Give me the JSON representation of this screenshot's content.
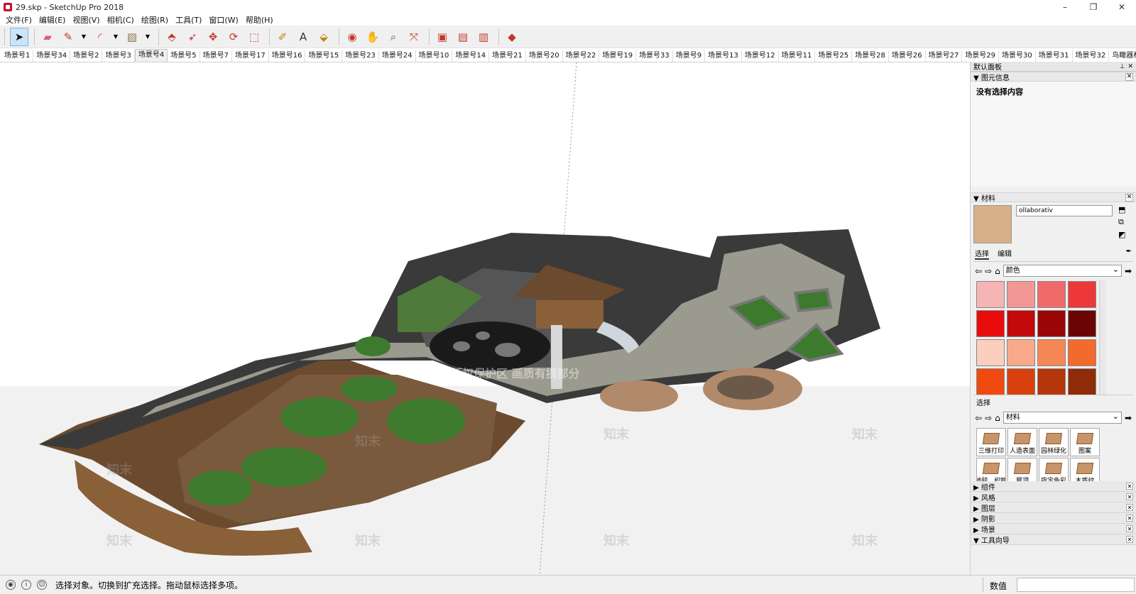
{
  "window": {
    "title": "29.skp - SketchUp Pro 2018",
    "controls": [
      "–",
      "❐",
      "✕"
    ]
  },
  "menu": [
    "文件(F)",
    "编辑(E)",
    "视图(V)",
    "相机(C)",
    "绘图(R)",
    "工具(T)",
    "窗口(W)",
    "帮助(H)"
  ],
  "toolbar": {
    "tools": [
      {
        "icon": "select-arrow-icon",
        "glyph": "➤",
        "color": "#111111",
        "active": true
      },
      {
        "icon": "eraser-icon",
        "glyph": "▰",
        "color": "#e05a7a"
      },
      {
        "icon": "pencil-icon",
        "glyph": "✎",
        "color": "#c0392b",
        "dropdown": true
      },
      {
        "icon": "arc-icon",
        "glyph": "◜",
        "color": "#c0392b",
        "dropdown": true
      },
      {
        "icon": "rectangle-icon",
        "glyph": "▨",
        "color": "#8b7355",
        "dropdown": true
      },
      {
        "icon": "push-pull-icon",
        "glyph": "⬘",
        "color": "#c0392b"
      },
      {
        "icon": "follow-me-icon",
        "glyph": "➶",
        "color": "#c0392b"
      },
      {
        "icon": "move-icon",
        "glyph": "✥",
        "color": "#c0392b"
      },
      {
        "icon": "rotate-icon",
        "glyph": "⟳",
        "color": "#c0392b"
      },
      {
        "icon": "scale-icon",
        "glyph": "⬚",
        "color": "#c0392b"
      },
      {
        "icon": "tape-measure-icon",
        "glyph": "✐",
        "color": "#b8860b"
      },
      {
        "icon": "text-icon",
        "glyph": "A",
        "color": "#333333"
      },
      {
        "icon": "paint-bucket-icon",
        "glyph": "⬙",
        "color": "#b8860b"
      },
      {
        "icon": "orbit-icon",
        "glyph": "◉",
        "color": "#c0392b"
      },
      {
        "icon": "pan-icon",
        "glyph": "✋",
        "color": "#b8860b"
      },
      {
        "icon": "zoom-icon",
        "glyph": "⌕",
        "color": "#1f4e79"
      },
      {
        "icon": "zoom-extents-icon",
        "glyph": "⤧",
        "color": "#c0392b"
      },
      {
        "icon": "warehouse-icon",
        "glyph": "▣",
        "color": "#c0392b"
      },
      {
        "icon": "extension-warehouse-icon",
        "glyph": "▤",
        "color": "#c0392b"
      },
      {
        "icon": "send-to-layout-icon",
        "glyph": "▥",
        "color": "#c0392b"
      },
      {
        "icon": "extension-manager-icon",
        "glyph": "◆",
        "color": "#c0392b"
      }
    ]
  },
  "scenes": {
    "active_index": 4,
    "tabs": [
      "场景号1",
      "场景号34",
      "场景号2",
      "场景号3",
      "场景号4",
      "场景号5",
      "场景号7",
      "场景号17",
      "场景号16",
      "场景号15",
      "场景号23",
      "场景号24",
      "场景号10",
      "场景号14",
      "场景号21",
      "场景号20",
      "场景号22",
      "场景号19",
      "场景号33",
      "场景号9",
      "场景号13",
      "场景号12",
      "场景号11",
      "场景号25",
      "场景号28",
      "场景号26",
      "场景号27",
      "场景号29",
      "场景号30",
      "场景号31",
      "场景号32",
      "鸟瞰器材"
    ]
  },
  "viewport": {
    "watermark_text": "知末",
    "overlay_text": "版权保护区  画质有损部分"
  },
  "tray": {
    "title": "默认面板",
    "entity_info": {
      "header": "图元信息",
      "body": "没有选择内容"
    },
    "materials": {
      "header": "材料",
      "name_value": "ollaborativ",
      "tabs": [
        "选择",
        "编辑"
      ],
      "collection_select": "颜色",
      "swatches": [
        "#f5b5b5",
        "#f39696",
        "#ef6b6b",
        "#ec3838",
        "#e80c0c",
        "#c30a0a",
        "#9a0606",
        "#6b0404",
        "#fbcfc0",
        "#f8a98c",
        "#f58756",
        "#f36a2e",
        "#f04a10",
        "#d8410d",
        "#b4360a",
        "#8f2b08"
      ],
      "select_label": "选择",
      "library_select": "材料",
      "library_items": [
        "三维打印",
        "人造表面",
        "园林绿化",
        "图案",
        "地毯、织物",
        "屋顶",
        "指定色彩",
        "木质纹"
      ]
    },
    "collapsed_panels": [
      "组件",
      "风格",
      "图层",
      "阴影",
      "场景",
      "工具向导"
    ]
  },
  "status": {
    "message": "选择对象。切换到扩充选择。拖动鼠标选择多项。",
    "measurements_label": "数值",
    "icons": [
      "geo-location-icon",
      "info-icon",
      "user-icon"
    ]
  }
}
